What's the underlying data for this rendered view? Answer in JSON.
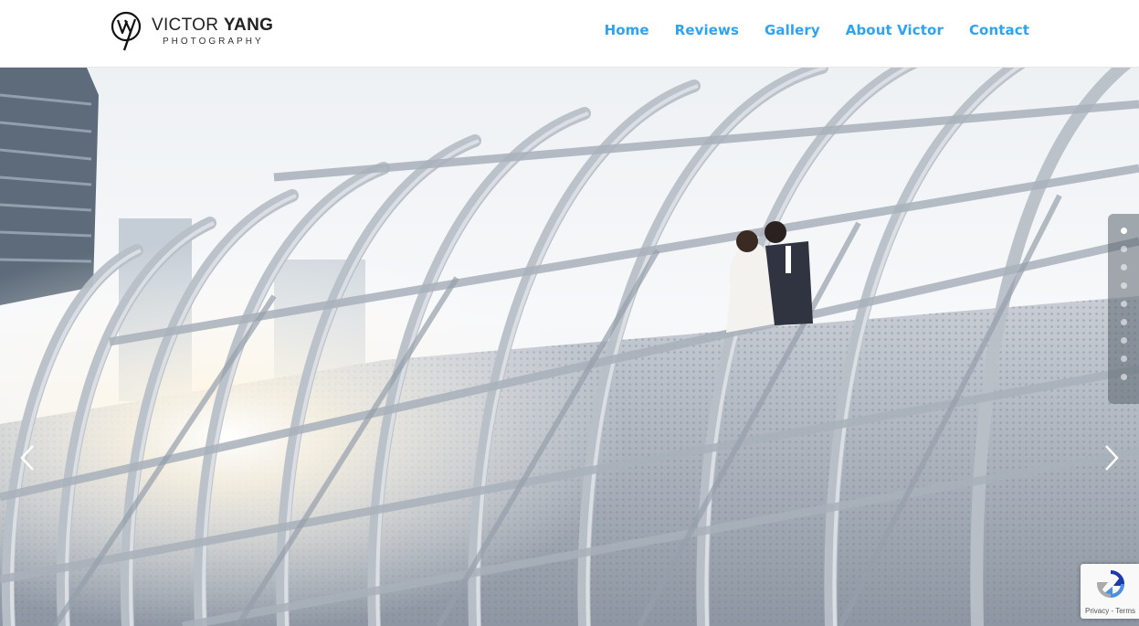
{
  "brand": {
    "name_light": "VICTOR ",
    "name_bold": "YANG",
    "subtitle": "PHOTOGRAPHY",
    "logo_icon": "vy-monogram-icon"
  },
  "nav": {
    "items": [
      {
        "label": "Home"
      },
      {
        "label": "Reviews"
      },
      {
        "label": "Gallery"
      },
      {
        "label": "About Victor"
      },
      {
        "label": "Contact"
      }
    ],
    "color": "#2ea3f2"
  },
  "slider": {
    "slide_count": 9,
    "active_index": 0,
    "prev_icon": "chevron-left-icon",
    "next_icon": "chevron-right-icon"
  },
  "recaptcha": {
    "privacy": "Privacy",
    "separator": " - ",
    "terms": "Terms",
    "icon": "recaptcha-icon"
  }
}
